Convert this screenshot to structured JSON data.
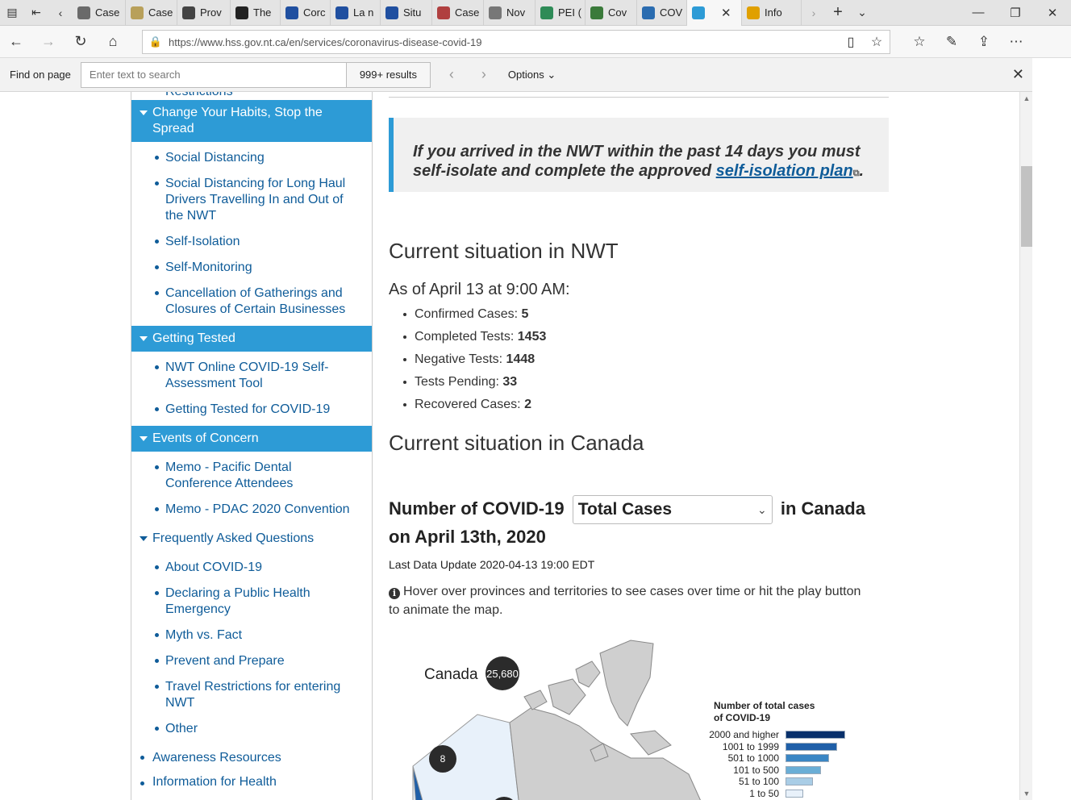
{
  "tabs": [
    {
      "label": "Case",
      "color": "#6a6a6a"
    },
    {
      "label": "Case",
      "color": "#b8a05a"
    },
    {
      "label": "Prov",
      "color": "#444444"
    },
    {
      "label": "The",
      "color": "#222222"
    },
    {
      "label": "Corc",
      "color": "#1f4fa0"
    },
    {
      "label": "La n",
      "color": "#1f4fa0"
    },
    {
      "label": "Situ",
      "color": "#1f4fa0"
    },
    {
      "label": "Case",
      "color": "#b04040"
    },
    {
      "label": "Nov",
      "color": "#777777"
    },
    {
      "label": "PEI (",
      "color": "#2e8b57"
    },
    {
      "label": "Cov",
      "color": "#3a7a3a"
    },
    {
      "label": "COV",
      "color": "#2a6cb0"
    },
    {
      "label": "",
      "color": "#2d9bd6"
    },
    {
      "label": "Info",
      "color": "#e0a000"
    }
  ],
  "address": {
    "url": "https://www.hss.gov.nt.ca/en/services/coronavirus-disease-covid-19"
  },
  "find": {
    "label": "Find on page",
    "placeholder": "Enter text to search",
    "results": "999+ results",
    "options": "Options"
  },
  "sidebar": {
    "clipped_top": "Restrictions",
    "sections": [
      {
        "title": "Change Your Habits, Stop the Spread",
        "items": [
          "Social Distancing",
          "Social Distancing for Long Haul Drivers Travelling In and Out of the NWT",
          "Self-Isolation",
          "Self-Monitoring",
          "Cancellation of Gatherings and Closures of Certain Businesses"
        ]
      },
      {
        "title": "Getting Tested",
        "items": [
          "NWT Online COVID-19 Self-Assessment Tool",
          "Getting Tested for COVID-19"
        ]
      },
      {
        "title": "Events of Concern",
        "items": [
          "Memo - Pacific Dental Conference Attendees",
          "Memo - PDAC 2020 Convention"
        ]
      },
      {
        "title": "Frequently Asked Questions",
        "items": [
          "About COVID-19",
          "Declaring a Public Health Emergency",
          "Myth vs. Fact",
          "Prevent and Prepare",
          "Travel Restrictions for entering NWT",
          "Other"
        ]
      }
    ],
    "awareness": "Awareness Resources",
    "clipped_bottom": "Information for Health"
  },
  "main": {
    "alert_text": "If you arrived in the NWT within the past 14 days you must self-isolate and complete the approved ",
    "alert_link": "self-isolation plan",
    "alert_end": ".",
    "nwt_heading": "Current situation in NWT",
    "as_of": "As of April 13 at 9:00 AM:",
    "stats": [
      {
        "label": "Confirmed Cases: ",
        "value": "5"
      },
      {
        "label": "Completed Tests: ",
        "value": "1453"
      },
      {
        "label": "Negative Tests: ",
        "value": "1448"
      },
      {
        "label": "Tests Pending: ",
        "value": "33"
      },
      {
        "label": "Recovered Cases: ",
        "value": "2"
      }
    ],
    "canada_heading": "Current situation in Canada",
    "covid_prefix": "Number of COVID-19",
    "covid_select": "Total Cases",
    "covid_suffix": "in Canada",
    "covid_date": "on April 13th, 2020",
    "last_update": "Last Data Update 2020-04-13 19:00 EDT",
    "hint": "Hover over provinces and territories to see cases over time or hit the play button to animate the map."
  },
  "map": {
    "canada_label": "Canada",
    "canada_total": "25,680",
    "nwt_bubble": "8",
    "legend_title": "Number of total cases of COVID-19",
    "legend": [
      {
        "label": "2000 and higher",
        "color": "#08306b"
      },
      {
        "label": "1001 to 1999",
        "color": "#1f5fa8"
      },
      {
        "label": "501 to 1000",
        "color": "#3a86c4"
      },
      {
        "label": "101 to 500",
        "color": "#6aaed6"
      },
      {
        "label": "51 to 100",
        "color": "#a9cde6"
      },
      {
        "label": "1 to 50",
        "color": "#e8f1fa"
      }
    ]
  }
}
